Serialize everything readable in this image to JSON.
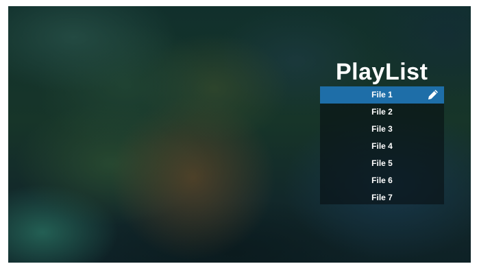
{
  "playlist": {
    "title": "PlayList",
    "selected_index": 0,
    "items": [
      {
        "label": "File 1"
      },
      {
        "label": "File 2"
      },
      {
        "label": "File 3"
      },
      {
        "label": "File 4"
      },
      {
        "label": "File 5"
      },
      {
        "label": "File 6"
      },
      {
        "label": "File 7"
      }
    ],
    "edit_icon": "pencil-icon"
  },
  "colors": {
    "selected_item": "#1e6ea8",
    "text": "#ffffff"
  }
}
